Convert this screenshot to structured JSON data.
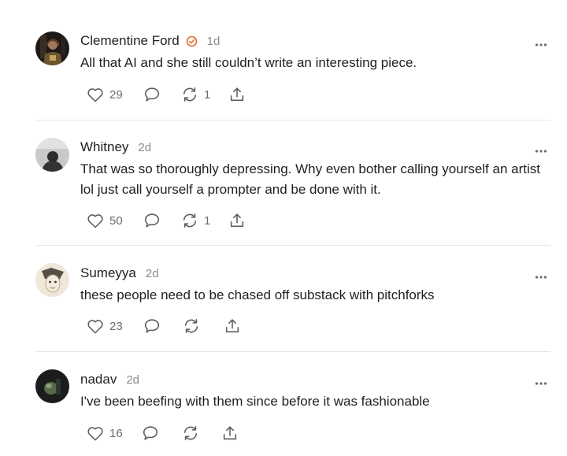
{
  "colors": {
    "text": "#1f1f1f",
    "muted": "#8a8a8a",
    "icon": "#5c5c5c",
    "verified_badge": "#e8692a",
    "divider": "#e6e6e6"
  },
  "icons": {
    "like": "heart-icon",
    "reply": "speech-bubble-icon",
    "restack": "restack-arrows-icon",
    "share": "share-upload-icon",
    "more": "more-dots-icon",
    "verified": "verified-check-icon"
  },
  "comments": [
    {
      "author": "Clementine Ford",
      "verified": true,
      "time": "1d",
      "text": "All that AI and she still couldn’t write an interesting piece.",
      "likes": "29",
      "restacks": "1"
    },
    {
      "author": "Whitney",
      "verified": false,
      "time": "2d",
      "text": "That was so thoroughly depressing. Why even bother calling yourself an artist lol just call yourself a prompter and be done with it.",
      "likes": "50",
      "restacks": "1"
    },
    {
      "author": "Sumeyya",
      "verified": false,
      "time": "2d",
      "text": "these people need to be chased off substack with pitchforks",
      "likes": "23",
      "restacks": ""
    },
    {
      "author": "nadav",
      "verified": false,
      "time": "2d",
      "text": "I've been beefing with them since before it was fashionable",
      "likes": "16",
      "restacks": ""
    }
  ]
}
